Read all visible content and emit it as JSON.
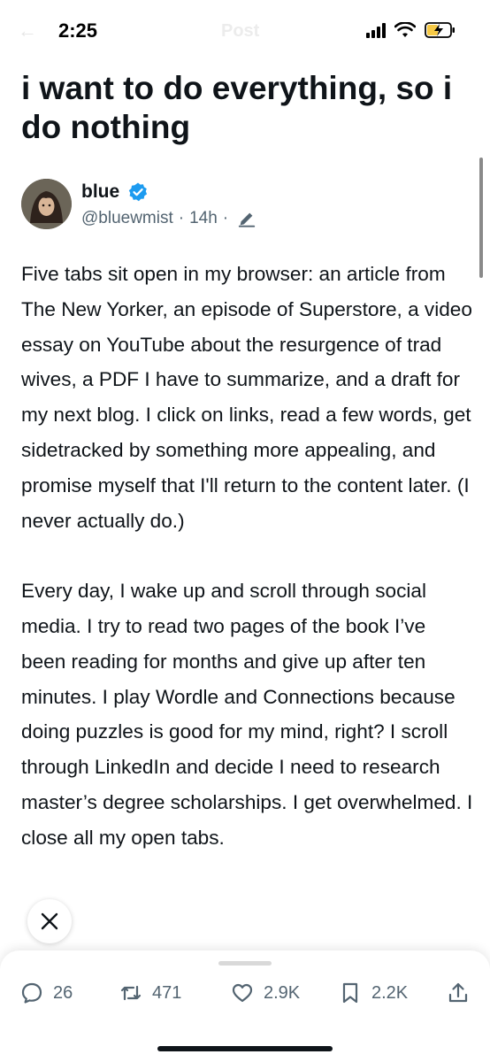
{
  "status_bar": {
    "time": "2:25",
    "ghost_back": "←",
    "ghost_title": "Post",
    "icons": [
      "signal-icon",
      "wifi-icon",
      "battery-charging-icon"
    ]
  },
  "article": {
    "title": "i want to do everything, so i do nothing"
  },
  "author": {
    "name": "blue",
    "verified": true,
    "handle": "@bluewmist",
    "separator": "·",
    "age": "14h",
    "separator2": "·"
  },
  "body": {
    "paragraphs": [
      "Five tabs sit open in my browser: an article from The New Yorker, an episode of Superstore, a video essay on YouTube about the resurgence of trad wives, a PDF I have to summarize, and a draft for my next blog. I click on links, read a few words, get sidetracked by something more appealing, and promise myself that I'll return to the content later. (I never actually do.)",
      "Every day, I wake up and scroll through social media. I try to read two pages of the book I’ve been reading for months and give up after ten minutes. I play Wordle and Connections because doing puzzles is good for my mind, right? I scroll through LinkedIn and decide I need to research master’s degree scholarships. I get overwhelmed. I close all my open tabs."
    ]
  },
  "actions": {
    "replies": "26",
    "reposts": "471",
    "likes": "2.9K",
    "bookmarks": "2.2K"
  },
  "colors": {
    "text": "#0f1419",
    "secondary": "#536471",
    "verified": "#1d9bf0"
  }
}
